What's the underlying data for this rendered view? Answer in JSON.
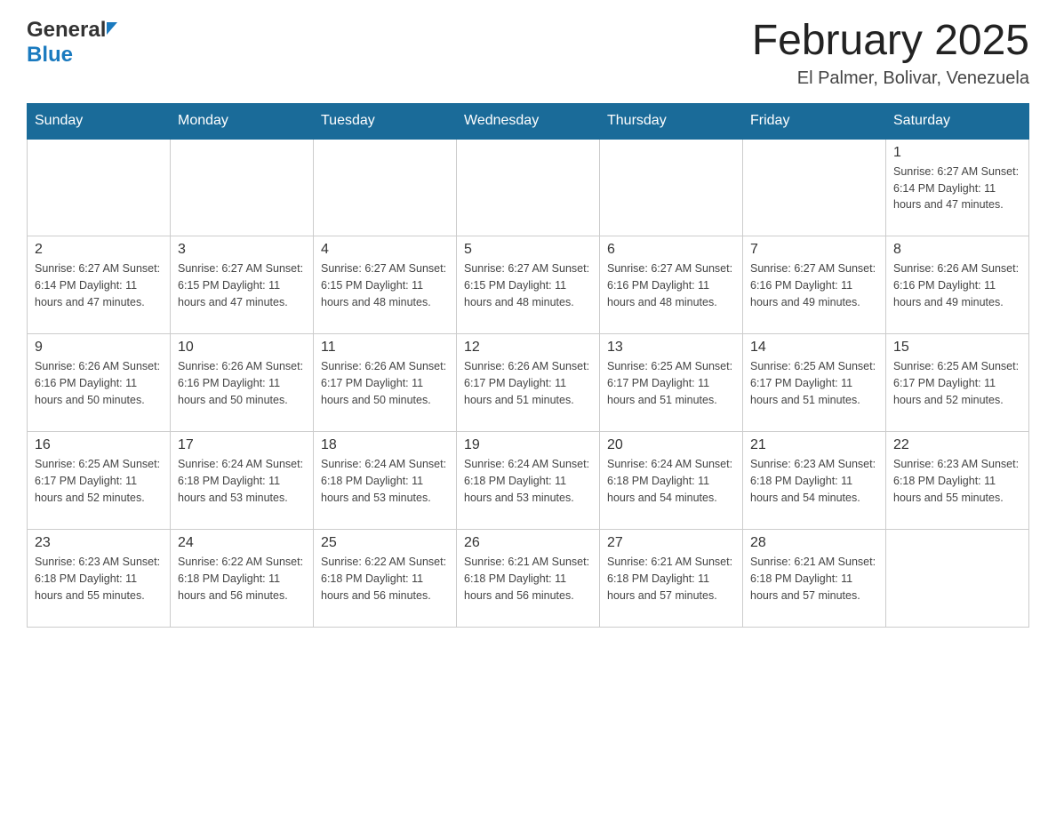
{
  "header": {
    "logo_general": "General",
    "logo_blue": "Blue",
    "title": "February 2025",
    "subtitle": "El Palmer, Bolivar, Venezuela"
  },
  "days_of_week": [
    "Sunday",
    "Monday",
    "Tuesday",
    "Wednesday",
    "Thursday",
    "Friday",
    "Saturday"
  ],
  "weeks": [
    [
      {
        "day": "",
        "info": ""
      },
      {
        "day": "",
        "info": ""
      },
      {
        "day": "",
        "info": ""
      },
      {
        "day": "",
        "info": ""
      },
      {
        "day": "",
        "info": ""
      },
      {
        "day": "",
        "info": ""
      },
      {
        "day": "1",
        "info": "Sunrise: 6:27 AM\nSunset: 6:14 PM\nDaylight: 11 hours\nand 47 minutes."
      }
    ],
    [
      {
        "day": "2",
        "info": "Sunrise: 6:27 AM\nSunset: 6:14 PM\nDaylight: 11 hours\nand 47 minutes."
      },
      {
        "day": "3",
        "info": "Sunrise: 6:27 AM\nSunset: 6:15 PM\nDaylight: 11 hours\nand 47 minutes."
      },
      {
        "day": "4",
        "info": "Sunrise: 6:27 AM\nSunset: 6:15 PM\nDaylight: 11 hours\nand 48 minutes."
      },
      {
        "day": "5",
        "info": "Sunrise: 6:27 AM\nSunset: 6:15 PM\nDaylight: 11 hours\nand 48 minutes."
      },
      {
        "day": "6",
        "info": "Sunrise: 6:27 AM\nSunset: 6:16 PM\nDaylight: 11 hours\nand 48 minutes."
      },
      {
        "day": "7",
        "info": "Sunrise: 6:27 AM\nSunset: 6:16 PM\nDaylight: 11 hours\nand 49 minutes."
      },
      {
        "day": "8",
        "info": "Sunrise: 6:26 AM\nSunset: 6:16 PM\nDaylight: 11 hours\nand 49 minutes."
      }
    ],
    [
      {
        "day": "9",
        "info": "Sunrise: 6:26 AM\nSunset: 6:16 PM\nDaylight: 11 hours\nand 50 minutes."
      },
      {
        "day": "10",
        "info": "Sunrise: 6:26 AM\nSunset: 6:16 PM\nDaylight: 11 hours\nand 50 minutes."
      },
      {
        "day": "11",
        "info": "Sunrise: 6:26 AM\nSunset: 6:17 PM\nDaylight: 11 hours\nand 50 minutes."
      },
      {
        "day": "12",
        "info": "Sunrise: 6:26 AM\nSunset: 6:17 PM\nDaylight: 11 hours\nand 51 minutes."
      },
      {
        "day": "13",
        "info": "Sunrise: 6:25 AM\nSunset: 6:17 PM\nDaylight: 11 hours\nand 51 minutes."
      },
      {
        "day": "14",
        "info": "Sunrise: 6:25 AM\nSunset: 6:17 PM\nDaylight: 11 hours\nand 51 minutes."
      },
      {
        "day": "15",
        "info": "Sunrise: 6:25 AM\nSunset: 6:17 PM\nDaylight: 11 hours\nand 52 minutes."
      }
    ],
    [
      {
        "day": "16",
        "info": "Sunrise: 6:25 AM\nSunset: 6:17 PM\nDaylight: 11 hours\nand 52 minutes."
      },
      {
        "day": "17",
        "info": "Sunrise: 6:24 AM\nSunset: 6:18 PM\nDaylight: 11 hours\nand 53 minutes."
      },
      {
        "day": "18",
        "info": "Sunrise: 6:24 AM\nSunset: 6:18 PM\nDaylight: 11 hours\nand 53 minutes."
      },
      {
        "day": "19",
        "info": "Sunrise: 6:24 AM\nSunset: 6:18 PM\nDaylight: 11 hours\nand 53 minutes."
      },
      {
        "day": "20",
        "info": "Sunrise: 6:24 AM\nSunset: 6:18 PM\nDaylight: 11 hours\nand 54 minutes."
      },
      {
        "day": "21",
        "info": "Sunrise: 6:23 AM\nSunset: 6:18 PM\nDaylight: 11 hours\nand 54 minutes."
      },
      {
        "day": "22",
        "info": "Sunrise: 6:23 AM\nSunset: 6:18 PM\nDaylight: 11 hours\nand 55 minutes."
      }
    ],
    [
      {
        "day": "23",
        "info": "Sunrise: 6:23 AM\nSunset: 6:18 PM\nDaylight: 11 hours\nand 55 minutes."
      },
      {
        "day": "24",
        "info": "Sunrise: 6:22 AM\nSunset: 6:18 PM\nDaylight: 11 hours\nand 56 minutes."
      },
      {
        "day": "25",
        "info": "Sunrise: 6:22 AM\nSunset: 6:18 PM\nDaylight: 11 hours\nand 56 minutes."
      },
      {
        "day": "26",
        "info": "Sunrise: 6:21 AM\nSunset: 6:18 PM\nDaylight: 11 hours\nand 56 minutes."
      },
      {
        "day": "27",
        "info": "Sunrise: 6:21 AM\nSunset: 6:18 PM\nDaylight: 11 hours\nand 57 minutes."
      },
      {
        "day": "28",
        "info": "Sunrise: 6:21 AM\nSunset: 6:18 PM\nDaylight: 11 hours\nand 57 minutes."
      },
      {
        "day": "",
        "info": ""
      }
    ]
  ]
}
